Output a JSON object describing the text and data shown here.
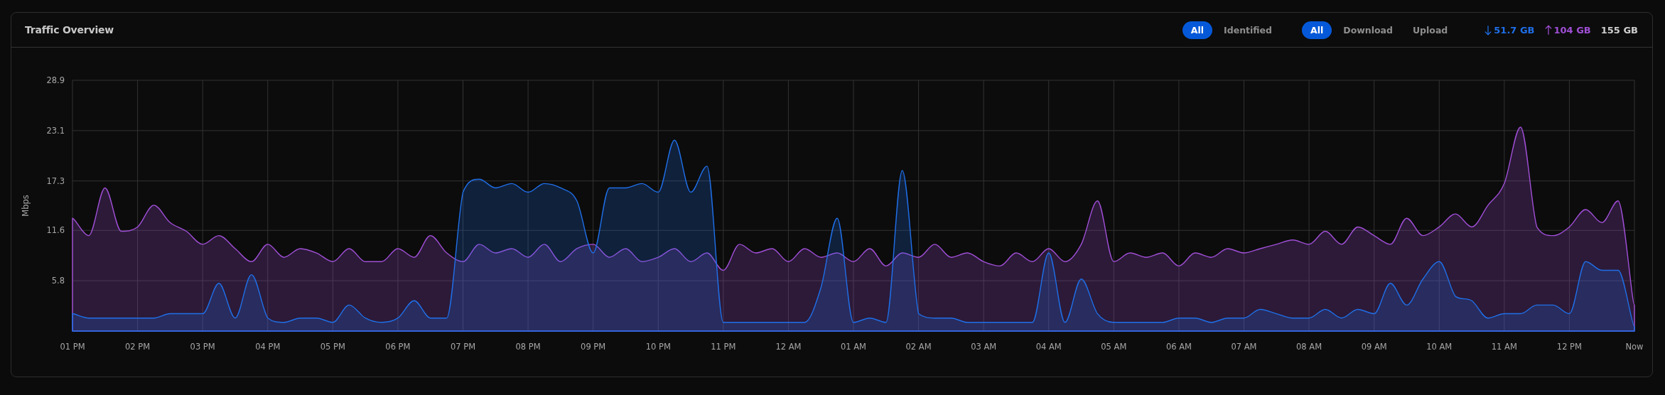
{
  "card": {
    "title": "Traffic Overview"
  },
  "scope_filters": [
    {
      "label": "All",
      "selected": true
    },
    {
      "label": "Identified",
      "selected": false
    }
  ],
  "direction_filters": [
    {
      "label": "All",
      "selected": true
    },
    {
      "label": "Download",
      "selected": false
    },
    {
      "label": "Upload",
      "selected": false
    }
  ],
  "totals": [
    {
      "kind": "download",
      "value": "51.7 GB"
    },
    {
      "kind": "upload",
      "value": "104 GB"
    },
    {
      "kind": "total",
      "value": "155 GB"
    }
  ],
  "chart": {
    "chart_data": {
      "type": "area",
      "ylabel": "Mbps",
      "stacked": false,
      "grid": true,
      "ylim": [
        0,
        28.9
      ],
      "yticks": [
        5.8,
        11.6,
        17.3,
        23.1,
        28.9
      ],
      "categories": [
        "01 PM",
        null,
        null,
        null,
        "02 PM",
        null,
        null,
        null,
        "03 PM",
        null,
        null,
        null,
        "04 PM",
        null,
        null,
        null,
        "05 PM",
        null,
        null,
        null,
        "06 PM",
        null,
        null,
        null,
        "07 PM",
        null,
        null,
        null,
        "08 PM",
        null,
        null,
        null,
        "09 PM",
        null,
        null,
        null,
        "10 PM",
        null,
        null,
        null,
        "11 PM",
        null,
        null,
        null,
        "12 AM",
        null,
        null,
        null,
        "01 AM",
        null,
        null,
        null,
        "02 AM",
        null,
        null,
        null,
        "03 AM",
        null,
        null,
        null,
        "04 AM",
        null,
        null,
        null,
        "05 AM",
        null,
        null,
        null,
        "06 AM",
        null,
        null,
        null,
        "07 AM",
        null,
        null,
        null,
        "08 AM",
        null,
        null,
        null,
        "09 AM",
        null,
        null,
        null,
        "10 AM",
        null,
        null,
        null,
        "11 AM",
        null,
        null,
        null,
        "12 PM",
        null,
        null,
        null,
        "Now"
      ],
      "series": [
        {
          "color": "#a04fd6",
          "values": [
            13,
            11,
            16.5,
            11.5,
            12,
            14.5,
            12.5,
            11.5,
            10,
            11,
            9.5,
            8,
            10,
            8.5,
            9.5,
            9,
            8,
            9.5,
            8,
            8,
            9.5,
            8.5,
            11,
            9,
            8,
            10,
            9,
            9.5,
            8.5,
            10,
            8,
            9.5,
            10,
            8.5,
            9.5,
            8,
            8.5,
            9.5,
            8,
            9,
            7,
            10,
            9,
            9.5,
            8,
            9.5,
            8.5,
            9,
            8,
            9.5,
            7.5,
            9,
            8.5,
            10,
            8.5,
            9,
            8,
            7.5,
            9,
            8,
            9.5,
            8,
            10,
            15,
            8,
            9,
            8.5,
            9,
            7.5,
            9,
            8.5,
            9.5,
            9,
            9.5,
            10,
            10.5,
            10,
            11.5,
            10,
            12,
            11,
            10,
            13,
            11,
            12,
            13.5,
            12,
            14.5,
            17,
            23.5,
            12,
            11,
            12,
            14,
            12.5,
            15,
            3
          ]
        },
        {
          "color": "#1f6fe8",
          "values": [
            2,
            1.5,
            1.5,
            1.5,
            1.5,
            1.5,
            2,
            2,
            2,
            5.5,
            1.5,
            6.5,
            1.5,
            1,
            1.5,
            1.5,
            1,
            3,
            1.5,
            1,
            1.5,
            3.5,
            1.5,
            1.5,
            16,
            17.5,
            16.5,
            17,
            16,
            17,
            16.5,
            15,
            9,
            16.5,
            16.5,
            17,
            16,
            22,
            16,
            19,
            1,
            1,
            1,
            1,
            1,
            1,
            5,
            13,
            1,
            1.5,
            1,
            18.5,
            2,
            1.5,
            1.5,
            1,
            1,
            1,
            1,
            1,
            9,
            1,
            6,
            2,
            1,
            1,
            1,
            1,
            1.5,
            1.5,
            1,
            1.5,
            1.5,
            2.5,
            2,
            1.5,
            1.5,
            2.5,
            1.5,
            2.5,
            2,
            5.5,
            3,
            6,
            8,
            4,
            3.5,
            1.5,
            2,
            2,
            3,
            3,
            2,
            8,
            7,
            7,
            0.5
          ]
        }
      ]
    }
  }
}
